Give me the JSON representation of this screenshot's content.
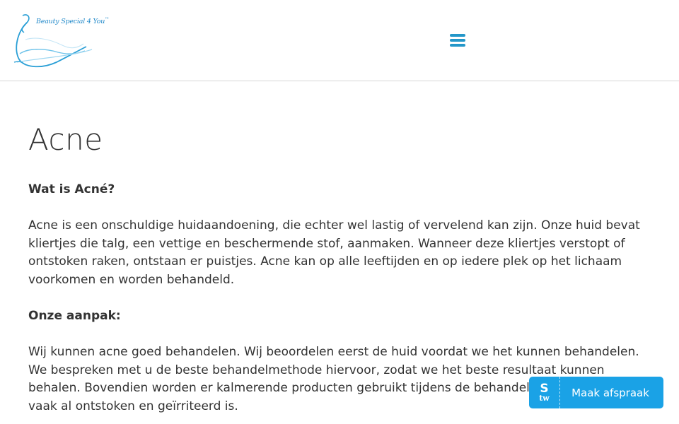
{
  "header": {
    "logo_text": "Beauty Special 4 You",
    "logo_trademark": "™",
    "menu_icon": "hamburger-menu-icon"
  },
  "page": {
    "title": "Acne"
  },
  "sections": [
    {
      "heading": "Wat is Acné?",
      "paragraph": "Acne is een onschuldige huidaandoening, die echter wel lastig of vervelend kan zijn. Onze huid bevat kliertjes die talg, een vettige en beschermende stof, aanmaken. Wanneer deze kliertjes verstopt of ontstoken raken, ontstaan er puistjes. Acne kan op alle leeftijden en op iedere plek op het lichaam voorkomen en worden behandeld."
    },
    {
      "heading": "Onze aanpak:",
      "paragraph": "Wij kunnen acne goed behandelen. Wij beoordelen eerst de huid voordat we het kunnen behandelen. We bespreken met u de beste behandelmethode hiervoor, zodat we het beste resultaat kunnen behalen. Bovendien worden er kalmerende producten gebruikt tijdens de behandeling, omdat de huid vaak al ontstoken en geïrriteerd is."
    }
  ],
  "booking_button": {
    "logo_s": "S",
    "logo_tw": "tw",
    "label": "Maak afspraak"
  },
  "colors": {
    "accent": "#1aa2e6",
    "menu_icon": "#2497c9",
    "logo": "#1f88c9",
    "text": "#333333",
    "header_border": "#d6d6d6"
  }
}
